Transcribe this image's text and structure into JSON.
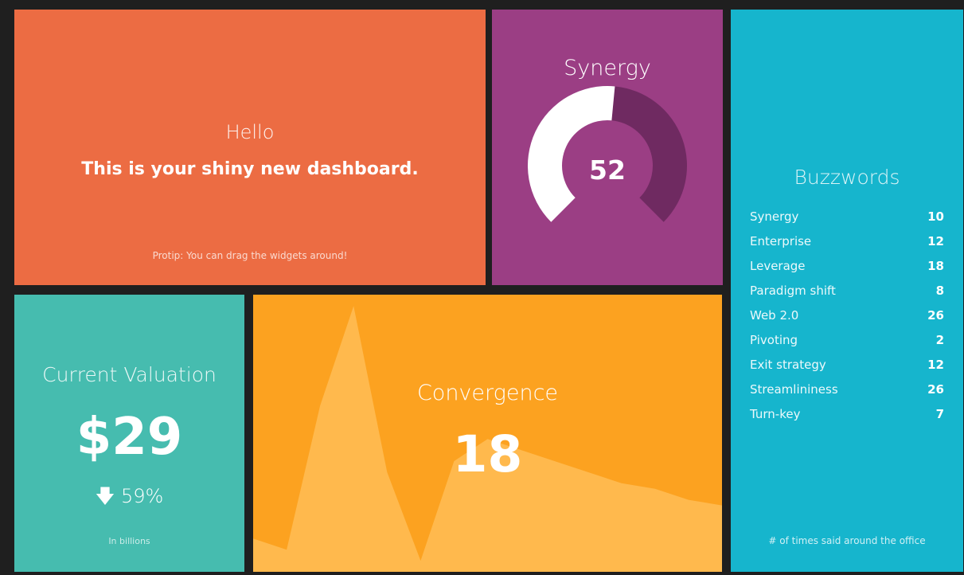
{
  "colors": {
    "background": "#1f1f1f",
    "hello": "#ec6c43",
    "synergy": "#9b3e84",
    "synergy_gauge_fill": "#ffffff",
    "synergy_gauge_track": "#6f2a61",
    "buzzwords": "#16b5cd",
    "valuation": "#46bcaf",
    "convergence": "#fca220",
    "convergence_area": "#ffb94d"
  },
  "hello": {
    "title": "Hello",
    "text": "This is your shiny new dashboard.",
    "more_info": "Protip: You can drag the widgets around!"
  },
  "synergy": {
    "title": "Synergy",
    "value": 52,
    "max": 100
  },
  "buzzwords": {
    "title": "Buzzwords",
    "items": [
      {
        "label": "Synergy",
        "value": "10"
      },
      {
        "label": "Enterprise",
        "value": "12"
      },
      {
        "label": "Leverage",
        "value": "18"
      },
      {
        "label": "Paradigm shift",
        "value": "8"
      },
      {
        "label": "Web 2.0",
        "value": "26"
      },
      {
        "label": "Pivoting",
        "value": "2"
      },
      {
        "label": "Exit strategy",
        "value": "12"
      },
      {
        "label": "Streamlininess",
        "value": "26"
      },
      {
        "label": "Turn-key",
        "value": "7"
      }
    ],
    "more_info": "# of times said around the office"
  },
  "valuation": {
    "title": "Current Valuation",
    "amount": "$29",
    "change_icon": "arrow-down-icon",
    "change_arrow": "🡇",
    "change": "59%",
    "more_info": "In billions"
  },
  "convergence": {
    "title": "Convergence",
    "value": "18",
    "series": [
      6,
      4,
      30,
      48,
      18,
      2,
      20,
      24,
      22,
      20,
      18,
      16,
      15,
      13,
      12
    ]
  }
}
